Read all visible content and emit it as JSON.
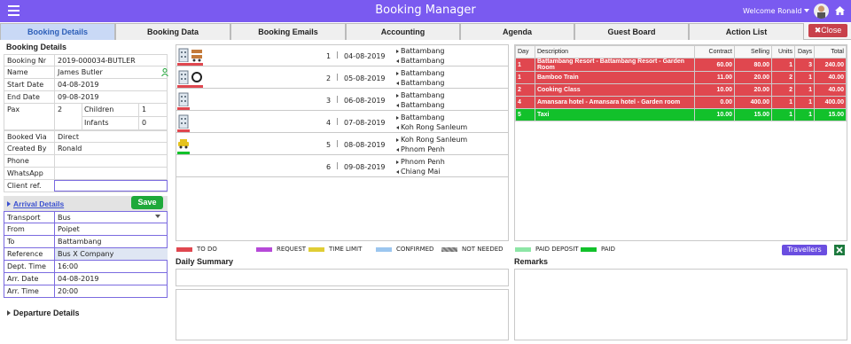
{
  "app": {
    "title": "Booking Manager",
    "welcome": "Welcome Ronald"
  },
  "tabs": [
    {
      "label": "Booking Details"
    },
    {
      "label": "Booking Data"
    },
    {
      "label": "Booking Emails"
    },
    {
      "label": "Accounting"
    },
    {
      "label": "Agenda"
    },
    {
      "label": "Guest Board"
    },
    {
      "label": "Action List"
    }
  ],
  "close_label": "✖Close",
  "details": {
    "title": "Booking Details",
    "rows": [
      {
        "label": "Booking Nr",
        "value": "2019-000034-BUTLER"
      },
      {
        "label": "Name",
        "value": "James Butler"
      },
      {
        "label": "Start Date",
        "value": "04-08-2019"
      },
      {
        "label": "End Date",
        "value": "09-08-2019"
      }
    ],
    "pax": {
      "label": "Pax",
      "value": "2",
      "children_label": "Children",
      "children": "1",
      "infants_label": "Infants",
      "infants": "0"
    },
    "rows2": [
      {
        "label": "Booked Via",
        "value": "Direct"
      },
      {
        "label": "Created By",
        "value": "Ronald"
      },
      {
        "label": "Phone",
        "value": ""
      },
      {
        "label": "WhatsApp",
        "value": ""
      },
      {
        "label": "Client ref.",
        "value": ""
      }
    ]
  },
  "arrival": {
    "title": "Arrival Details",
    "save": "Save",
    "rows": [
      {
        "label": "Transport",
        "value": "Bus"
      },
      {
        "label": "From",
        "value": "Poipet"
      },
      {
        "label": "To",
        "value": "Battambang"
      },
      {
        "label": "Reference",
        "value": "Bus X Company"
      },
      {
        "label": "Dept. Time",
        "value": "16:00"
      },
      {
        "label": "Arr. Date",
        "value": "04-08-2019"
      },
      {
        "label": "Arr. Time",
        "value": "20:00"
      }
    ]
  },
  "departure_title": "Departure Details",
  "itinerary": [
    {
      "num": "1",
      "date": "04-08-2019",
      "from": "Battambang",
      "to": "Battambang"
    },
    {
      "num": "2",
      "date": "05-08-2019",
      "from": "Battambang",
      "to": "Battambang"
    },
    {
      "num": "3",
      "date": "06-08-2019",
      "from": "Battambang",
      "to": "Battambang"
    },
    {
      "num": "4",
      "date": "07-08-2019",
      "from": "Battambang",
      "to": "Koh Rong Sanleum"
    },
    {
      "num": "5",
      "date": "08-08-2019",
      "from": "Koh Rong Sanleum",
      "to": "Phnom Penh"
    },
    {
      "num": "6",
      "date": "09-08-2019",
      "from": "Phnom Penh",
      "to": "Chiang Mai"
    }
  ],
  "services": {
    "headers": [
      "Day",
      "Description",
      "Contract",
      "Selling",
      "Units",
      "Days",
      "Total"
    ],
    "rows": [
      {
        "day": "1",
        "desc": "Battambang Resort - Battambang Resort - Garden Room",
        "contract": "60.00",
        "selling": "80.00",
        "units": "1",
        "days": "3",
        "total": "240.00",
        "color": "#e0474f"
      },
      {
        "day": "1",
        "desc": "Bamboo Train",
        "contract": "11.00",
        "selling": "20.00",
        "units": "2",
        "days": "1",
        "total": "40.00",
        "color": "#e0474f"
      },
      {
        "day": "2",
        "desc": "Cooking Class",
        "contract": "10.00",
        "selling": "20.00",
        "units": "2",
        "days": "1",
        "total": "40.00",
        "color": "#e0474f"
      },
      {
        "day": "4",
        "desc": "Amansara hotel - Amansara hotel - Garden room",
        "contract": "0.00",
        "selling": "400.00",
        "units": "1",
        "days": "1",
        "total": "400.00",
        "color": "#e0474f"
      },
      {
        "day": "5",
        "desc": "Taxi",
        "contract": "10.00",
        "selling": "15.00",
        "units": "1",
        "days": "1",
        "total": "15.00",
        "color": "#12c12b"
      }
    ]
  },
  "legend": [
    {
      "label": "TO DO",
      "color": "#e0474f"
    },
    {
      "label": "REQUEST",
      "color": "#b649d8"
    },
    {
      "label": "TIME LIMIT",
      "color": "#e0cd35"
    },
    {
      "label": "CONFIRMED",
      "color": "#9bc6ef"
    },
    {
      "label": "NOT NEEDED",
      "color": "#777777"
    },
    {
      "label": "PAID DEPOSIT",
      "color": "#8de6a6"
    },
    {
      "label": "PAID",
      "color": "#12c12b"
    }
  ],
  "travellers_label": "Travellers",
  "daily_summary_title": "Daily Summary",
  "remarks_title": "Remarks"
}
